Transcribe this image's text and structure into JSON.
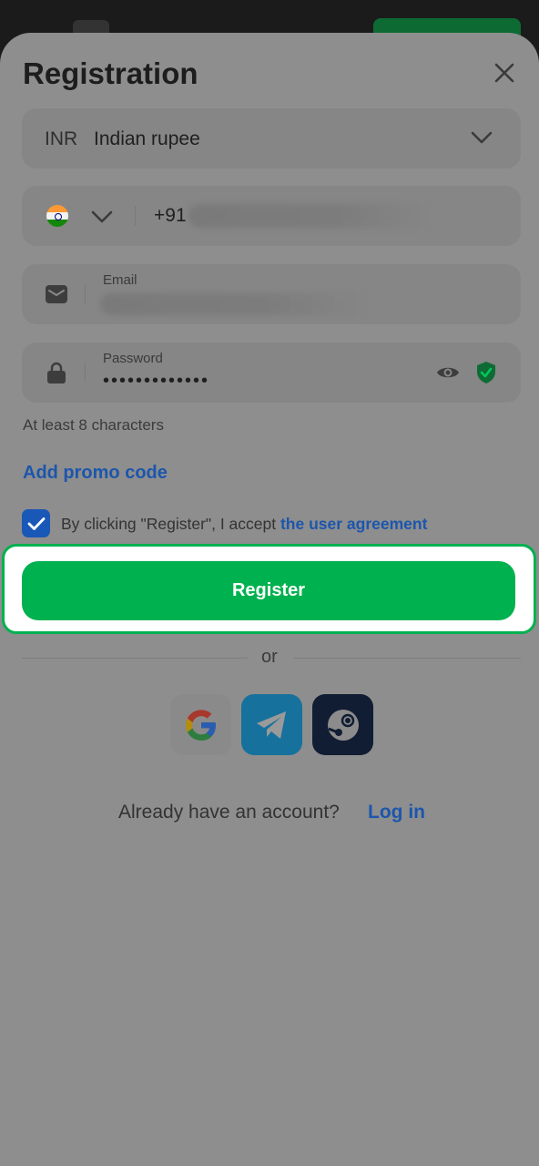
{
  "title": "Registration",
  "currency": {
    "code": "INR",
    "name": "Indian rupee"
  },
  "phone": {
    "prefix": "+91"
  },
  "email": {
    "label": "Email"
  },
  "password": {
    "label": "Password",
    "masked_value": "•••••••••••••",
    "hint": "At least 8 characters"
  },
  "promo_link": "Add promo code",
  "agreement": {
    "checked": true,
    "text": "By clicking \"Register\", I accept ",
    "link": "the user agreement"
  },
  "register_button": "Register",
  "divider_text": "or",
  "social": [
    "google-icon",
    "telegram-icon",
    "steam-icon"
  ],
  "footer": {
    "question": "Already have an account?",
    "login_link": "Log in"
  },
  "colors": {
    "accent_green": "#00b14f",
    "link_blue": "#1c56ad",
    "checkbox_blue": "#1a58b8"
  }
}
